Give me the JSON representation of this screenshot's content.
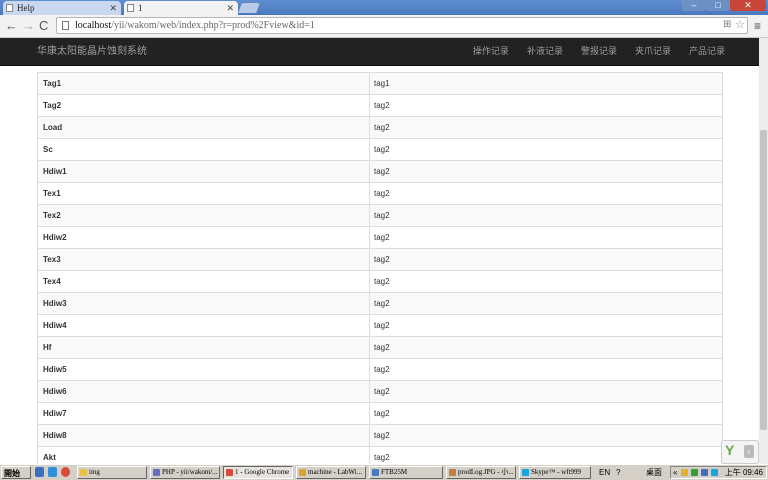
{
  "browser": {
    "tabs": [
      {
        "title": "Help",
        "active": false
      },
      {
        "title": "1",
        "active": true
      }
    ],
    "url_host": "localhost",
    "url_path": "/yii/wakom/web/index.php?r=prod%2Fview&id=1",
    "window_controls": {
      "minimize": "–",
      "maximize": "□",
      "close": "✕"
    },
    "nav": {
      "back": "←",
      "forward": "→",
      "reload": "C"
    }
  },
  "app": {
    "brand": "华康太阳能晶片蚀刻系统",
    "nav_links": [
      "操作记录",
      "补液记录",
      "警报记录",
      "夹爪记录",
      "产品记录"
    ]
  },
  "detail_table": {
    "rows": [
      {
        "key": "Tag1",
        "value": "tag1"
      },
      {
        "key": "Tag2",
        "value": "tag2"
      },
      {
        "key": "Load",
        "value": "tag2"
      },
      {
        "key": "Sc",
        "value": "tag2"
      },
      {
        "key": "Hdiw1",
        "value": "tag2"
      },
      {
        "key": "Tex1",
        "value": "tag2"
      },
      {
        "key": "Tex2",
        "value": "tag2"
      },
      {
        "key": "Hdiw2",
        "value": "tag2"
      },
      {
        "key": "Tex3",
        "value": "tag2"
      },
      {
        "key": "Tex4",
        "value": "tag2"
      },
      {
        "key": "Hdiw3",
        "value": "tag2"
      },
      {
        "key": "Hdiw4",
        "value": "tag2"
      },
      {
        "key": "Hf",
        "value": "tag2"
      },
      {
        "key": "Hdiw5",
        "value": "tag2"
      },
      {
        "key": "Hdiw6",
        "value": "tag2"
      },
      {
        "key": "Hdiw7",
        "value": "tag2"
      },
      {
        "key": "Hdiw8",
        "value": "tag2"
      },
      {
        "key": "Akt",
        "value": "tag2"
      }
    ]
  },
  "taskbar": {
    "start": "開始",
    "items": [
      {
        "label": "img",
        "active": false,
        "icon_color": "#e8c04a"
      },
      {
        "label": "PHP - yii/wakom/...",
        "active": false,
        "icon_color": "#6b6bbf"
      },
      {
        "label": "1 - Google Chrome",
        "active": true,
        "icon_color": "#d94a38"
      },
      {
        "label": "machine - LabWi...",
        "active": false,
        "icon_color": "#e0a030"
      },
      {
        "label": "FTB25M",
        "active": false,
        "icon_color": "#4a7ac0"
      },
      {
        "label": "prodLog.JPG - 小...",
        "active": false,
        "icon_color": "#c08040"
      },
      {
        "label": "Skype™ - wft999",
        "active": false,
        "icon_color": "#19a3e0"
      }
    ],
    "lang": "EN",
    "desktop": "桌面",
    "clock": "上午 09:46"
  }
}
